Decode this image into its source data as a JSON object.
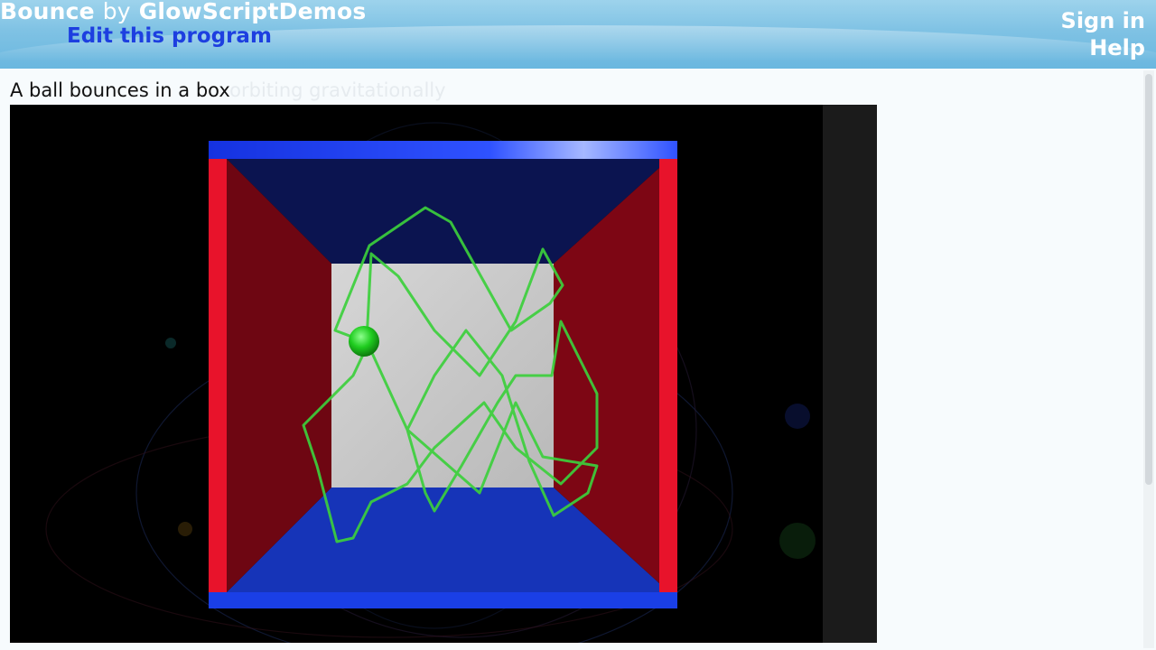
{
  "header": {
    "program_name": "Bounce",
    "by_text": "by",
    "author": "GlowScriptDemos",
    "edit_link": "Edit this program",
    "sign_in": "Sign in",
    "help": "Help"
  },
  "description": "A ball bounces in a box",
  "ghost_text": "orbiting gravitationally",
  "colors": {
    "header_bg": "#7fc2e4",
    "link_blue": "#1d3fe0",
    "wall_red": "#e8132b",
    "wall_blue": "#1a3fe6",
    "trail_green": "#3ccf3c",
    "ball_green": "#1fcc1f"
  }
}
